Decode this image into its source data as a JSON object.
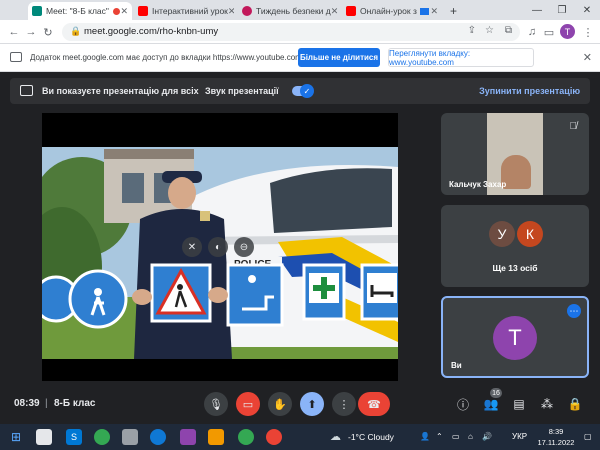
{
  "browser": {
    "tabs": [
      {
        "label": "Meet: \"8-Б клас\"",
        "active": true,
        "favicon_color": "#00897b"
      },
      {
        "label": "Інтерактивний урок",
        "active": false,
        "favicon_color": "#ff0000"
      },
      {
        "label": "Тиждень безпеки д",
        "active": false,
        "favicon_color": "#c2185b"
      },
      {
        "label": "Онлайн-урок з",
        "active": false,
        "favicon_color": "#ff0000"
      }
    ],
    "new_tab": "+",
    "url": "meet.google.com/rho-knbn-umy",
    "profile_initial": "T"
  },
  "infobar": {
    "message": "Додаток meet.google.com має доступ до вкладки https://www.youtube.com",
    "stop_sharing": "Більше не ділитися",
    "switch_tab": "Переглянути вкладку: www.youtube.com"
  },
  "present_bar": {
    "title": "Ви показуєте презентацію для всіх",
    "sound_label": "Звук презентації",
    "stop_label": "Зупинити презентацію"
  },
  "video": {
    "car_text": "POLICE"
  },
  "participants": {
    "tile1_name": "Кальчук Захар",
    "tile2_avatars": [
      {
        "initial": "У",
        "color": "#6d4c41"
      },
      {
        "initial": "К",
        "color": "#c4471f"
      }
    ],
    "tile2_label": "Ще 13 осіб",
    "tile3_initial": "T",
    "tile3_color": "#8e44ad",
    "tile3_name": "Ви"
  },
  "meeting": {
    "time": "08:39",
    "separator": "|",
    "room": "8-Б клас",
    "people_count": "16"
  },
  "taskbar": {
    "weather": "-1°C  Cloudy",
    "lang": "УКР",
    "time": "8:39",
    "date": "17.11.2022"
  }
}
